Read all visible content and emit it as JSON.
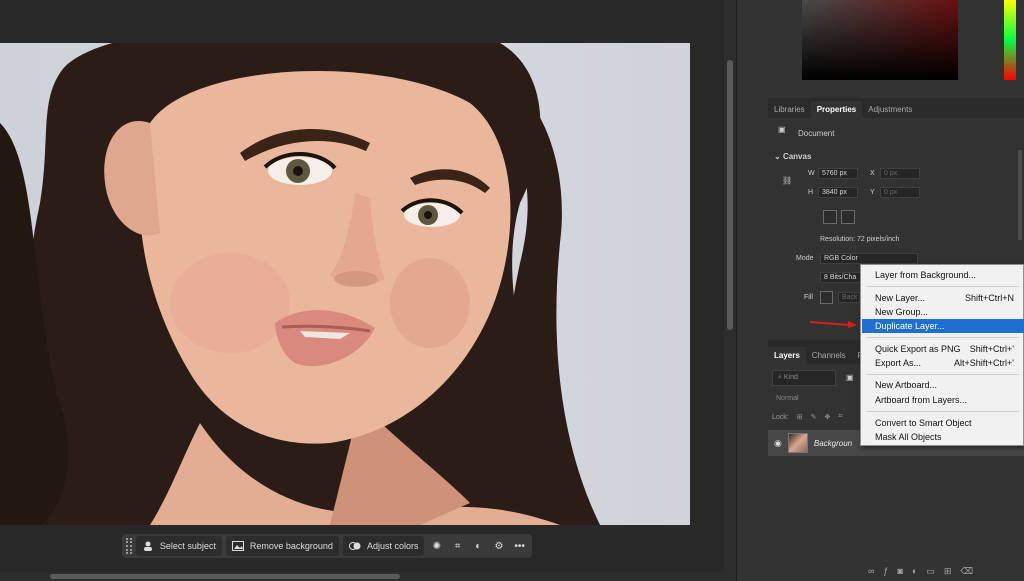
{
  "properties_panel": {
    "tabs": [
      {
        "label": "Libraries"
      },
      {
        "label": "Properties"
      },
      {
        "label": "Adjustments"
      }
    ],
    "section_label": "Document",
    "canvas_label": "Canvas",
    "width_label": "W",
    "width_value": "5760 px",
    "height_label": "H",
    "height_value": "3840 px",
    "x_label": "X",
    "x_value": "0 px",
    "y_label": "Y",
    "y_value": "0 px",
    "resolution": "Resolution: 72 pixels/inch",
    "mode_label": "Mode",
    "mode_value": "RGB Color",
    "bits_value": "8 Bits/Cha",
    "fill_label": "Fill",
    "fill_value": "Back"
  },
  "layers_panel": {
    "tabs": [
      {
        "label": "Layers"
      },
      {
        "label": "Channels"
      },
      {
        "label": "P"
      }
    ],
    "kind_placeholder": "Kind",
    "blend_mode": "Normal",
    "lock_label": "Lock:",
    "layer_name": "Backgroun"
  },
  "context_menu": {
    "items": [
      {
        "label": "Layer from Background...",
        "shortcut": ""
      },
      {
        "label": "New Layer...",
        "shortcut": "Shift+Ctrl+N"
      },
      {
        "label": "New Group...",
        "shortcut": ""
      },
      {
        "label": "Duplicate Layer...",
        "shortcut": "",
        "highlighted": true
      },
      {
        "label": "Quick Export as PNG",
        "shortcut": "Shift+Ctrl+'"
      },
      {
        "label": "Export As...",
        "shortcut": "Alt+Shift+Ctrl+'"
      },
      {
        "label": "New Artboard...",
        "shortcut": ""
      },
      {
        "label": "Artboard from Layers...",
        "shortcut": ""
      },
      {
        "label": "Convert to Smart Object",
        "shortcut": ""
      },
      {
        "label": "Mask All Objects",
        "shortcut": ""
      }
    ]
  },
  "taskbar": {
    "select_subject": "Select subject",
    "remove_background": "Remove background",
    "adjust_colors": "Adjust colors",
    "more": "•••"
  },
  "colors": {
    "highlight": "#1f6fd0",
    "annotation_arrow": "#d42020"
  }
}
